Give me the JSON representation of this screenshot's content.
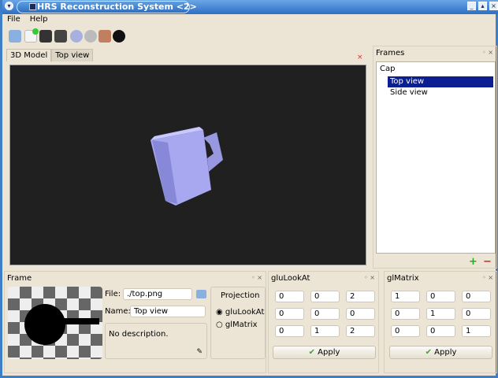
{
  "window": {
    "title": "HRS Reconstruction System <2>"
  },
  "menu": [
    "File",
    "Help"
  ],
  "toolbar": [
    "print-icon",
    "new-icon",
    "save-icon",
    "save-as-icon",
    "settings-icon",
    "stop-icon",
    "brush-icon",
    "render-icon"
  ],
  "tabs": [
    "3D Model",
    "Top view"
  ],
  "frames": {
    "title": "Frames",
    "root": "Cap",
    "items": [
      "Top view",
      "Side view"
    ],
    "selected": 0
  },
  "frame": {
    "title": "Frame",
    "file_label": "File:",
    "file": "./top.png",
    "name_label": "Name:",
    "name": "Top view",
    "description": "No description.",
    "projection": {
      "title": "Projection",
      "options": [
        "gluLookAt",
        "glMatrix"
      ],
      "selected": 0
    }
  },
  "glulookat": {
    "title": "gluLookAt",
    "values": [
      "0",
      "0",
      "2",
      "0",
      "0",
      "0",
      "0",
      "1",
      "2"
    ],
    "apply": "Apply"
  },
  "glmatrix": {
    "title": "glMatrix",
    "values": [
      "1",
      "0",
      "0",
      "0",
      "1",
      "0",
      "0",
      "0",
      "1"
    ],
    "apply": "Apply"
  },
  "dock_buttons": {
    "float": "◦",
    "close": "×"
  }
}
